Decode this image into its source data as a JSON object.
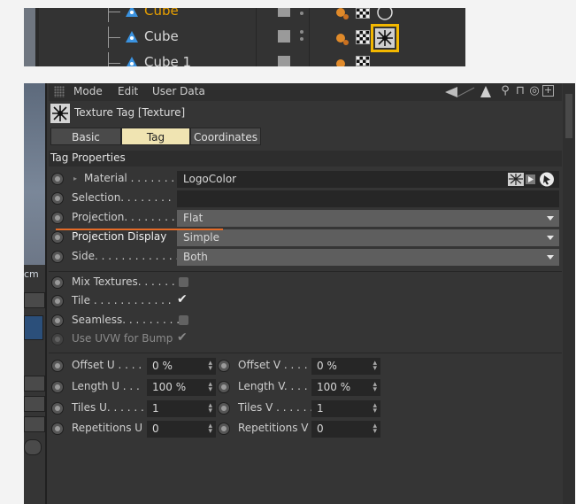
{
  "object_manager": {
    "rows": [
      {
        "name": "Cube",
        "highlighted_name": true
      },
      {
        "name": "Cube",
        "highlighted_name": false
      },
      {
        "name": "Cube 1",
        "highlighted_name": false
      }
    ],
    "name_color_active": "#e8a000",
    "selected_tag_outline": "#f2b700"
  },
  "menubar": {
    "items": [
      "Mode",
      "Edit",
      "User Data"
    ],
    "icons": [
      "back-arrow-icon",
      "up-arrow-icon",
      "search-icon",
      "lock-icon",
      "target-icon",
      "new-window-icon"
    ]
  },
  "tag": {
    "title": "Texture Tag [Texture]",
    "icon": "texture-tag-icon"
  },
  "tabs": [
    {
      "label": "Basic",
      "active": false
    },
    {
      "label": "Tag",
      "active": true
    },
    {
      "label": "Coordinates",
      "active": false
    }
  ],
  "section": {
    "title": "Tag Properties"
  },
  "properties": {
    "material": {
      "label": "Material . . . . . . .",
      "value": "LogoColor"
    },
    "selection": {
      "label": "Selection. . . . . . . .",
      "value": ""
    },
    "projection": {
      "label": "Projection. . . . . . . .",
      "value": "Flat"
    },
    "projection_display": {
      "label": "Projection Display",
      "value": "Simple"
    },
    "side": {
      "label": "Side. . . . . . . . . . . . .",
      "value": "Both"
    },
    "mix_textures": {
      "label": "Mix Textures. . . . . .",
      "checked": false
    },
    "tile": {
      "label": "Tile . . . . . . . . . . . .",
      "checked": true
    },
    "seamless": {
      "label": "Seamless. . . . . . . . .",
      "checked": false
    },
    "use_uvw_for_bump": {
      "label": "Use UVW for Bump",
      "checked": true,
      "disabled": true
    }
  },
  "numeric": {
    "offset_u": {
      "label": "Offset U . . . .",
      "value": "0 %"
    },
    "offset_v": {
      "label": "Offset V . . . .",
      "value": "0 %"
    },
    "length_u": {
      "label": "Length U . . .",
      "value": "100 %"
    },
    "length_v": {
      "label": "Length V. . . .",
      "value": "100 %"
    },
    "tiles_u": {
      "label": "Tiles U. . . . . .",
      "value": "1"
    },
    "tiles_v": {
      "label": "Tiles V . . . . . .",
      "value": "1"
    },
    "repetitions_u": {
      "label": "Repetitions U",
      "value": "0"
    },
    "repetitions_v": {
      "label": "Repetitions V",
      "value": "0"
    }
  },
  "viewport_fragment": {
    "label": "cm"
  },
  "colors": {
    "panel_bg": "#353535",
    "active_tab": "#f0e4b2",
    "annotation_underline": "#e46b28"
  }
}
